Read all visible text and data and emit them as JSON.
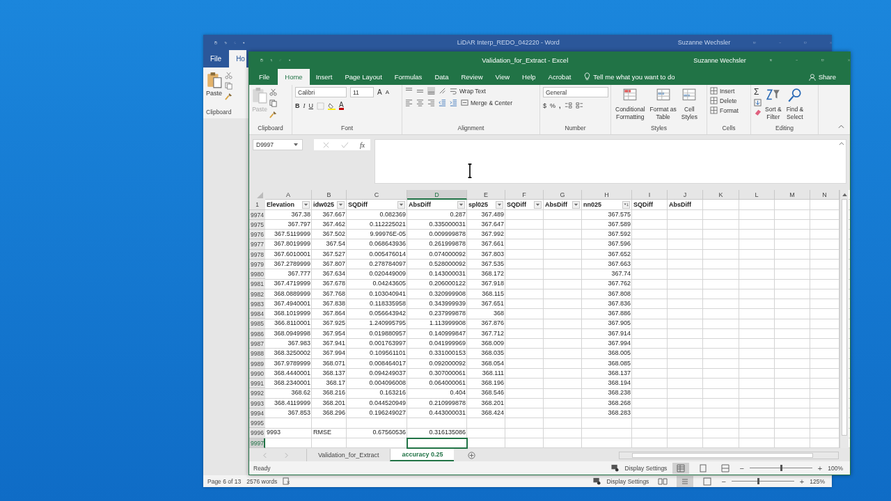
{
  "word": {
    "title": "LiDAR Interp_REDO_042220 - Word",
    "user": "Suzanne Wechsler",
    "tabs": [
      {
        "label": "File",
        "selected": false
      },
      {
        "label": "Ho",
        "selected": true
      }
    ],
    "paste": "Paste",
    "clipboard": "Clipboard",
    "status": {
      "page": "Page 6 of 13",
      "words": "2576 words",
      "display": "Display Settings",
      "zoom_out": "−",
      "zoom_in": "+",
      "zoom": "125%",
      "level": 0.42
    }
  },
  "excel": {
    "title": "Validation_for_Extract  -  Excel",
    "user": "Suzanne Wechsler",
    "tabs": [
      {
        "label": "File",
        "selected": false
      },
      {
        "label": "Home",
        "selected": true
      },
      {
        "label": "Insert",
        "selected": false
      },
      {
        "label": "Page Layout",
        "selected": false
      },
      {
        "label": "Formulas",
        "selected": false
      },
      {
        "label": "Data",
        "selected": false
      },
      {
        "label": "Review",
        "selected": false
      },
      {
        "label": "View",
        "selected": false
      },
      {
        "label": "Help",
        "selected": false
      },
      {
        "label": "Acrobat",
        "selected": false
      }
    ],
    "tell_me": "Tell me what you want to do",
    "share": "Share",
    "ribbon": {
      "clipboard": {
        "title": "Clipboard",
        "paste": "Paste"
      },
      "font": {
        "title": "Font",
        "name": "Calibri",
        "size": "11",
        "grow": "A",
        "shrink": "A",
        "bold": "B",
        "italic": "I",
        "underline": "U",
        "color_letter": "A"
      },
      "alignment": {
        "title": "Alignment",
        "wrap": "Wrap Text",
        "merge": "Merge & Center"
      },
      "number": {
        "title": "Number",
        "format": "General",
        "currency": "$",
        "percent": "%",
        "comma": ","
      },
      "styles": {
        "title": "Styles",
        "buttons": [
          [
            "Conditional",
            "Formatting"
          ],
          [
            "Format as",
            "Table"
          ],
          [
            "Cell",
            "Styles"
          ]
        ]
      },
      "cells": {
        "title": "Cells",
        "buttons": [
          "Insert",
          "Delete",
          "Format"
        ]
      },
      "editing": {
        "title": "Editing",
        "sum": "Σ",
        "buttons": [
          [
            "Sort &",
            "Filter"
          ],
          [
            "Find &",
            "Select"
          ]
        ]
      }
    },
    "name_box": "D9997",
    "fx": "fx",
    "sheet": {
      "header_row": "1",
      "columns": [
        {
          "letter": "A",
          "header": "Elevation",
          "filter": true,
          "sorted": false,
          "selected": false
        },
        {
          "letter": "B",
          "header": "idw025",
          "filter": true,
          "sorted": false,
          "selected": false
        },
        {
          "letter": "C",
          "header": "SQDiff",
          "filter": true,
          "sorted": false,
          "selected": false
        },
        {
          "letter": "D",
          "header": "AbsDiff",
          "filter": true,
          "sorted": false,
          "selected": true
        },
        {
          "letter": "E",
          "header": "spl025",
          "filter": true,
          "sorted": false,
          "selected": false
        },
        {
          "letter": "F",
          "header": "SQDiff",
          "filter": true,
          "sorted": false,
          "selected": false
        },
        {
          "letter": "G",
          "header": "AbsDiff",
          "filter": true,
          "sorted": false,
          "selected": false
        },
        {
          "letter": "H",
          "header": "nn025",
          "filter": true,
          "sorted": true,
          "selected": false
        },
        {
          "letter": "I",
          "header": "SQDiff",
          "filter": false,
          "selected": false
        },
        {
          "letter": "J",
          "header": "AbsDiff",
          "filter": false,
          "selected": false
        },
        {
          "letter": "K",
          "selected": false
        },
        {
          "letter": "L",
          "selected": false
        },
        {
          "letter": "M",
          "selected": false
        },
        {
          "letter": "N",
          "selected": false
        }
      ],
      "rows": [
        {
          "n": "9974",
          "selected": false,
          "cells": {
            "A": "367.38",
            "B": "367.667",
            "C": "0.082369",
            "D": "0.287",
            "E": "367.489",
            "H": "367.575"
          }
        },
        {
          "n": "9975",
          "selected": false,
          "cells": {
            "A": "367.797",
            "B": "367.462",
            "C": "0.112225021",
            "D": "0.335000031",
            "E": "367.647",
            "H": "367.589"
          }
        },
        {
          "n": "9976",
          "selected": false,
          "cells": {
            "A": "367.5119999",
            "B": "367.502",
            "C": "9.99976E-05",
            "D": "0.009999878",
            "E": "367.992",
            "H": "367.592"
          }
        },
        {
          "n": "9977",
          "selected": false,
          "cells": {
            "A": "367.8019999",
            "B": "367.54",
            "C": "0.068643936",
            "D": "0.261999878",
            "E": "367.661",
            "H": "367.596"
          }
        },
        {
          "n": "9978",
          "selected": false,
          "cells": {
            "A": "367.6010001",
            "B": "367.527",
            "C": "0.005476014",
            "D": "0.074000092",
            "E": "367.803",
            "H": "367.652"
          }
        },
        {
          "n": "9979",
          "selected": false,
          "cells": {
            "A": "367.2789999",
            "B": "367.807",
            "C": "0.278784097",
            "D": "0.528000092",
            "E": "367.535",
            "H": "367.663"
          }
        },
        {
          "n": "9980",
          "selected": false,
          "cells": {
            "A": "367.777",
            "B": "367.634",
            "C": "0.020449009",
            "D": "0.143000031",
            "E": "368.172",
            "H": "367.74"
          }
        },
        {
          "n": "9981",
          "selected": false,
          "cells": {
            "A": "367.4719999",
            "B": "367.678",
            "C": "0.04243605",
            "D": "0.206000122",
            "E": "367.918",
            "H": "367.762"
          }
        },
        {
          "n": "9982",
          "selected": false,
          "cells": {
            "A": "368.0889999",
            "B": "367.768",
            "C": "0.103040941",
            "D": "0.320999908",
            "E": "368.115",
            "H": "367.808"
          }
        },
        {
          "n": "9983",
          "selected": false,
          "cells": {
            "A": "367.4940001",
            "B": "367.838",
            "C": "0.118335958",
            "D": "0.343999939",
            "E": "367.651",
            "H": "367.836"
          }
        },
        {
          "n": "9984",
          "selected": false,
          "cells": {
            "A": "368.1019999",
            "B": "367.864",
            "C": "0.056643942",
            "D": "0.237999878",
            "E": "368",
            "H": "367.886"
          }
        },
        {
          "n": "9985",
          "selected": false,
          "cells": {
            "A": "366.8110001",
            "B": "367.925",
            "C": "1.240995795",
            "D": "1.113999908",
            "E": "367.876",
            "H": "367.905"
          }
        },
        {
          "n": "9986",
          "selected": false,
          "cells": {
            "A": "368.0949998",
            "B": "367.954",
            "C": "0.019880957",
            "D": "0.140999847",
            "E": "367.712",
            "H": "367.914"
          }
        },
        {
          "n": "9987",
          "selected": false,
          "cells": {
            "A": "367.983",
            "B": "367.941",
            "C": "0.001763997",
            "D": "0.041999969",
            "E": "368.009",
            "H": "367.994"
          }
        },
        {
          "n": "9988",
          "selected": false,
          "cells": {
            "A": "368.3250002",
            "B": "367.994",
            "C": "0.109561101",
            "D": "0.331000153",
            "E": "368.035",
            "H": "368.005"
          }
        },
        {
          "n": "9989",
          "selected": false,
          "cells": {
            "A": "367.9789999",
            "B": "368.071",
            "C": "0.008464017",
            "D": "0.092000092",
            "E": "368.054",
            "H": "368.085"
          }
        },
        {
          "n": "9990",
          "selected": false,
          "cells": {
            "A": "368.4440001",
            "B": "368.137",
            "C": "0.094249037",
            "D": "0.307000061",
            "E": "368.111",
            "H": "368.137"
          }
        },
        {
          "n": "9991",
          "selected": false,
          "cells": {
            "A": "368.2340001",
            "B": "368.17",
            "C": "0.004096008",
            "D": "0.064000061",
            "E": "368.196",
            "H": "368.194"
          }
        },
        {
          "n": "9992",
          "selected": false,
          "cells": {
            "A": "368.62",
            "B": "368.216",
            "C": "0.163216",
            "D": "0.404",
            "E": "368.546",
            "H": "368.238"
          }
        },
        {
          "n": "9993",
          "selected": false,
          "cells": {
            "A": "368.4119999",
            "B": "368.201",
            "C": "0.044520949",
            "D": "0.210999878",
            "E": "368.201",
            "H": "368.268"
          }
        },
        {
          "n": "9994",
          "selected": false,
          "cells": {
            "A": "367.853",
            "B": "368.296",
            "C": "0.196249027",
            "D": "0.443000031",
            "E": "368.424",
            "H": "368.283"
          }
        },
        {
          "n": "9995",
          "selected": false
        },
        {
          "n": "9996",
          "selected": false,
          "cells": {
            "A": {
              "text": "9993",
              "left": true
            },
            "B": {
              "text": "RMSE",
              "left": true
            },
            "C": "0.67560536",
            "D": "0.316135086"
          }
        },
        {
          "n": "9997",
          "selected": true
        }
      ]
    },
    "sheet_tabs": [
      {
        "label": "Validation_for_Extract",
        "selected": false
      },
      {
        "label": "accuracy 0.25",
        "selected": true
      }
    ],
    "status": {
      "ready": "Ready",
      "display": "Display Settings",
      "zoom_out": "−",
      "zoom_in": "+",
      "zoom": "100%",
      "level": 0.5
    }
  }
}
